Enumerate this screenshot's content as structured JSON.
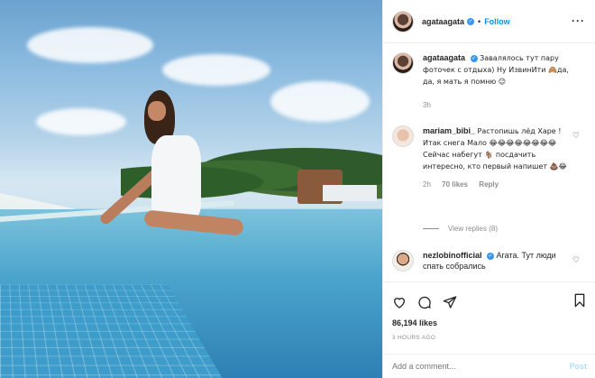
{
  "post": {
    "username": "agataagata",
    "follow_label": "Follow",
    "caption": "Завалялось тут пару фоточек с отдыха) Ну ИзвинИти 🙈да, да, я мать я помню 😉",
    "caption_time": "3h"
  },
  "comments": [
    {
      "user": "mariam_bibi_",
      "text": "Растопишь лёд Харе ! Итак снега Мало 😂😂😂😂😂😂😂😂Сейчас набегут 🐐 посдачить интересно, кто первый напишет 💩😂",
      "time": "2h",
      "likes": "70 likes",
      "reply": "Reply"
    },
    {
      "user": "nezlobinofficial",
      "text": "Агата. Тут люди спать собрались"
    }
  ],
  "view_replies": "View replies (8)",
  "likes": "86,194 likes",
  "time_ago": "3 HOURS AGO",
  "add_comment_placeholder": "Add a comment...",
  "post_label": "Post"
}
